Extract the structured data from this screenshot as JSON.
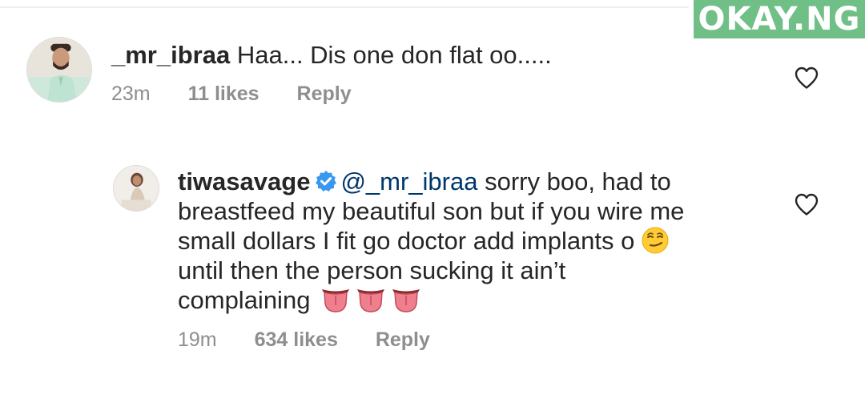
{
  "watermark": {
    "text": "OKAY.NG",
    "color": "#6fbf87"
  },
  "comments": [
    {
      "username": "_mr_ibraa",
      "text": "Haa... Dis one don flat oo.....",
      "time": "23m",
      "likes": "11 likes",
      "reply": "Reply",
      "avatar": "avatar-man-photo",
      "like_icon": "heart-outline-icon"
    },
    {
      "username": "tiwasavage",
      "verified": true,
      "verified_icon": "verified-badge-icon",
      "mention": "@_mr_ibraa",
      "lines": [
        "sorry boo, had to",
        "breastfeed my beautiful son but if you wire me",
        "small dollars I fit go doctor add implants o",
        "until then the person sucking it ain’t",
        "complaining"
      ],
      "emojis": [
        "smirking-face-emoji",
        "tongue-emoji",
        "tongue-emoji",
        "tongue-emoji"
      ],
      "time": "19m",
      "likes": "634 likes",
      "reply": "Reply",
      "avatar": "avatar-woman-photo",
      "like_icon": "heart-outline-icon"
    }
  ],
  "colors": {
    "text": "#262626",
    "meta": "#8e8e8e",
    "mention": "#00376b",
    "verified": "#3897f0"
  }
}
